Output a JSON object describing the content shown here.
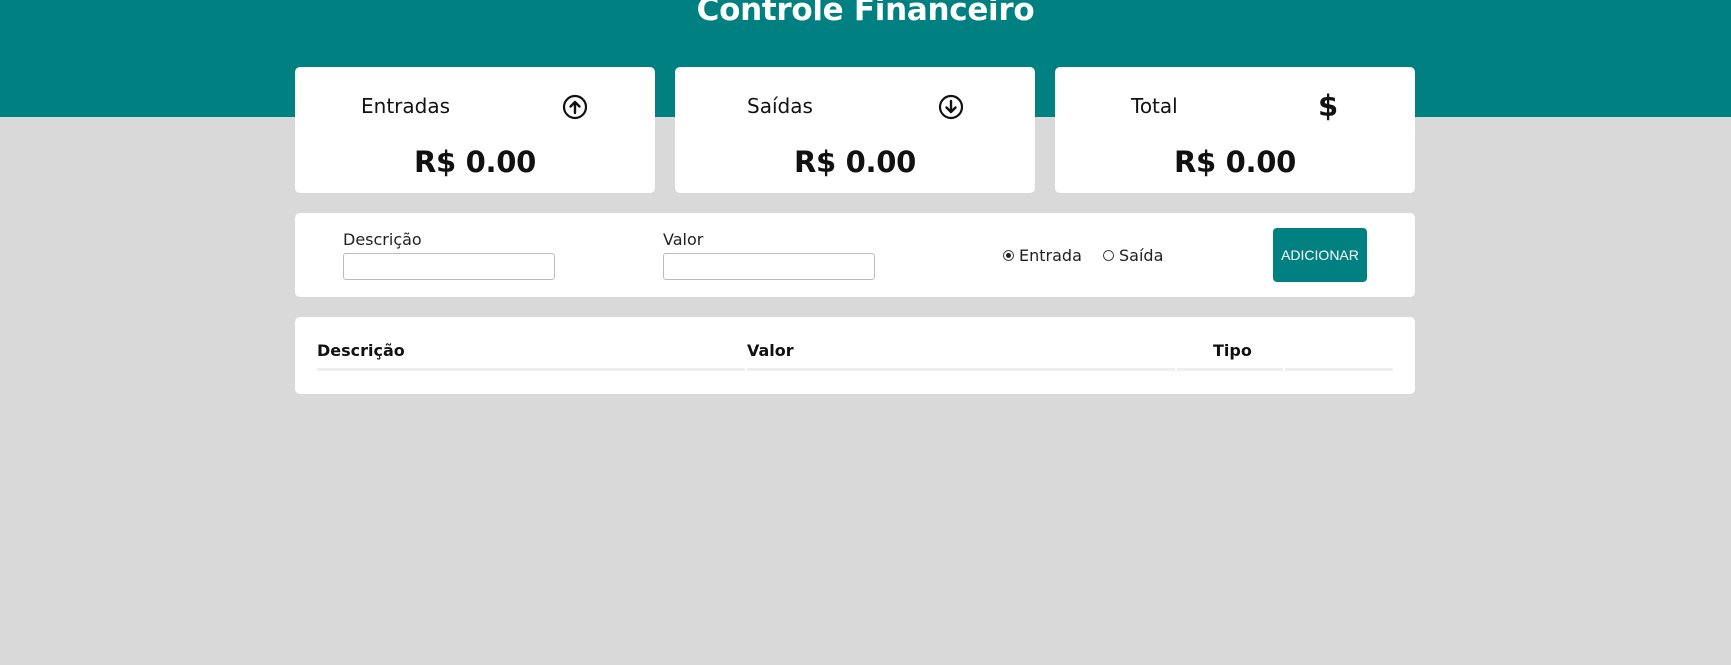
{
  "header": {
    "title": "Controle Financeiro",
    "background_color": "#008080"
  },
  "cards": [
    {
      "label": "Entradas",
      "icon": "arrow-up-circle-icon",
      "value": "R$ 0.00"
    },
    {
      "label": "Saídas",
      "icon": "arrow-down-circle-icon",
      "value": "R$ 0.00"
    },
    {
      "label": "Total",
      "icon": "dollar-icon",
      "icon_glyph": "$",
      "value": "R$ 0.00"
    }
  ],
  "form": {
    "description_label": "Descrição",
    "description_value": "",
    "value_label": "Valor",
    "value_value": "",
    "radio_options": [
      {
        "label": "Entrada",
        "checked": true
      },
      {
        "label": "Saída",
        "checked": false
      }
    ],
    "add_button_label": "ADICIONAR"
  },
  "table": {
    "columns": [
      "Descrição",
      "Valor",
      "Tipo",
      ""
    ],
    "rows": []
  },
  "colors": {
    "accent": "#008080",
    "page_background": "#d9d9d9",
    "panel_background": "#ffffff"
  }
}
